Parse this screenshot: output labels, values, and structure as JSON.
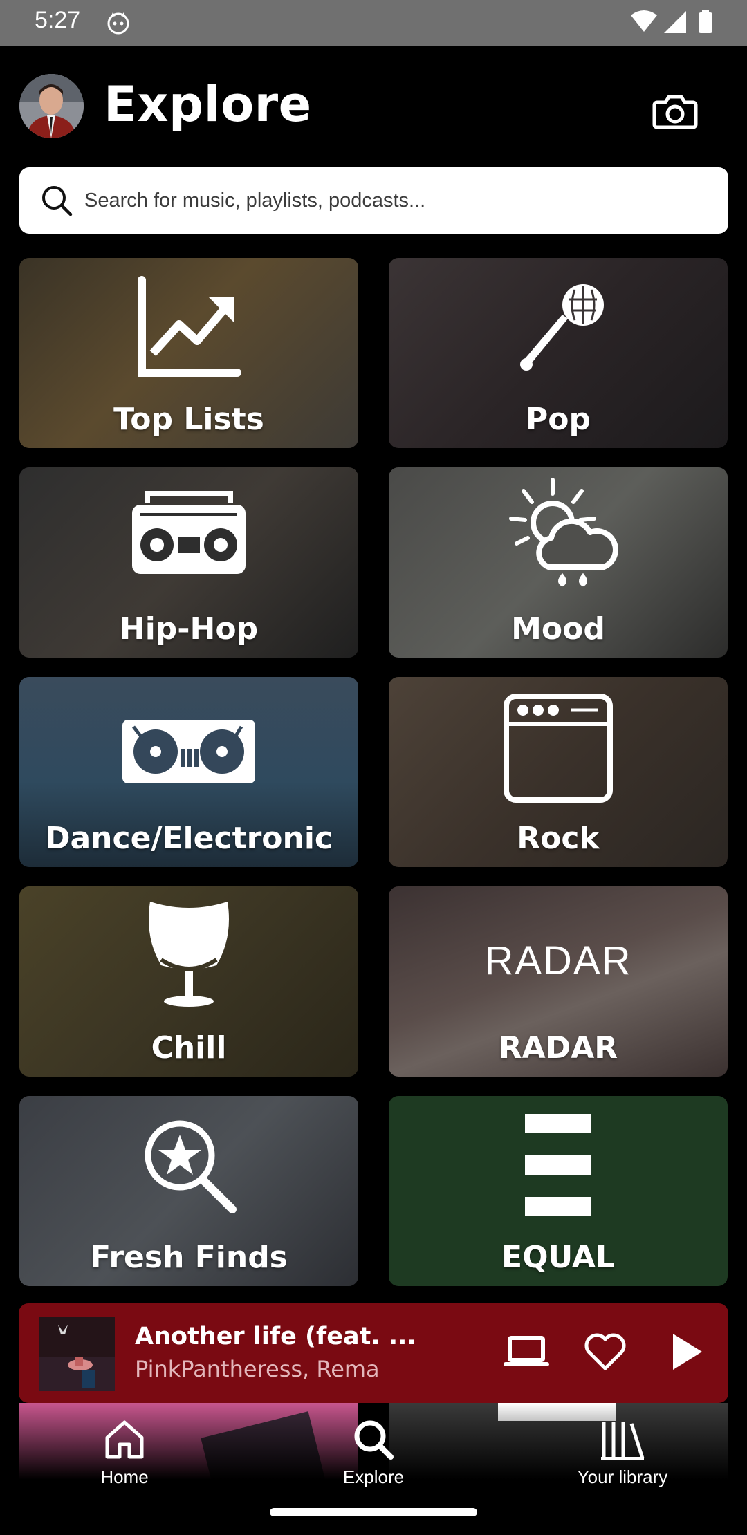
{
  "status_bar": {
    "time": "5:27"
  },
  "header": {
    "title": "Explore"
  },
  "search": {
    "placeholder": "Search for music, playlists, podcasts..."
  },
  "categories": [
    {
      "label": "Top Lists",
      "icon": "trending-up-icon"
    },
    {
      "label": "Pop",
      "icon": "microphone-icon"
    },
    {
      "label": "Hip-Hop",
      "icon": "boombox-icon"
    },
    {
      "label": "Mood",
      "icon": "weather-sun-cloud-icon"
    },
    {
      "label": "Dance/Electronic",
      "icon": "turntables-icon"
    },
    {
      "label": "Rock",
      "icon": "amplifier-icon"
    },
    {
      "label": "Chill",
      "icon": "egg-chair-icon"
    },
    {
      "label": "RADAR",
      "icon": "radar-wordmark",
      "wordmark": "RADAR"
    },
    {
      "label": "Fresh Finds",
      "icon": "star-search-icon"
    },
    {
      "label": "EQUAL",
      "icon": "equal-bars-icon"
    }
  ],
  "mini_player": {
    "title": "Another life (feat. ...",
    "artist": "PinkPantheress, Rema",
    "background": "#7a0a12"
  },
  "nav": {
    "items": [
      {
        "label": "Home",
        "icon": "home-icon"
      },
      {
        "label": "Explore",
        "icon": "explore-search-icon"
      },
      {
        "label": "Your library",
        "icon": "library-icon"
      }
    ]
  },
  "colors": {
    "equal_tile": "#1e3a22",
    "radar_tile": "#4a3f3d"
  }
}
